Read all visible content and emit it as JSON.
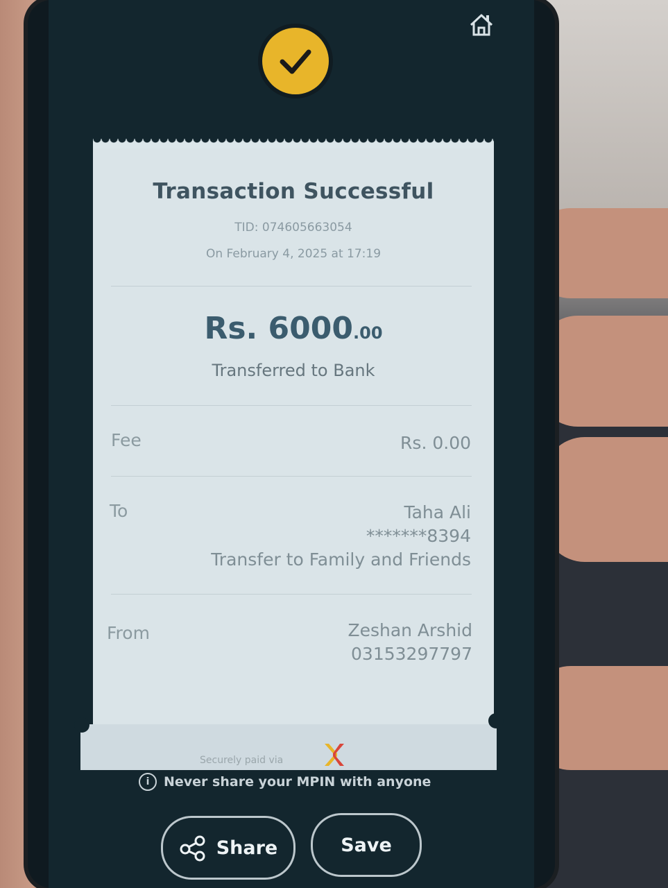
{
  "receipt": {
    "title": "Transaction Successful",
    "tid": "TID: 074605663054",
    "date": "On February 4, 2025 at 17:19",
    "amount_main": "Rs. 6000",
    "amount_decimals": ".00",
    "subtitle": "Transferred to Bank",
    "fee_label": "Fee",
    "fee_value": "Rs. 0.00",
    "to_label": "To",
    "to_name": "Taha Ali",
    "to_account": "*******8394",
    "to_purpose": "Transfer to Family and Friends",
    "from_label": "From",
    "from_name": "Zeshan Arshid",
    "from_number": "03153297797",
    "secure_text": "Securely paid via"
  },
  "warning": "Never share your MPIN with anyone",
  "actions": {
    "share_label": "Share",
    "save_label": "Save"
  },
  "icons": {
    "home": "home-icon",
    "check": "check-icon",
    "share": "share-icon",
    "info": "info-icon"
  },
  "colors": {
    "accent": "#e8b52a",
    "background": "#13262e",
    "receipt": "#dae4e8"
  }
}
